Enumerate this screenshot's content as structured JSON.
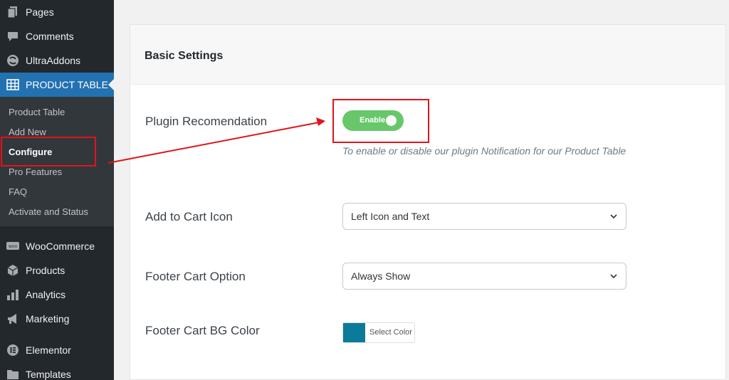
{
  "sidebar": {
    "items": [
      {
        "label": "Pages",
        "icon": "pages-icon"
      },
      {
        "label": "Comments",
        "icon": "comments-icon"
      },
      {
        "label": "UltraAddons",
        "icon": "ultraaddons-icon"
      },
      {
        "label": "PRODUCT TABLE",
        "icon": "table-icon"
      },
      {
        "label": "WooCommerce",
        "icon": "woocommerce-icon"
      },
      {
        "label": "Products",
        "icon": "products-icon"
      },
      {
        "label": "Analytics",
        "icon": "analytics-icon"
      },
      {
        "label": "Marketing",
        "icon": "marketing-icon"
      },
      {
        "label": "Elementor",
        "icon": "elementor-icon"
      },
      {
        "label": "Templates",
        "icon": "templates-icon"
      }
    ],
    "submenu": [
      {
        "label": "Product Table"
      },
      {
        "label": "Add New"
      },
      {
        "label": "Configure"
      },
      {
        "label": "Pro Features"
      },
      {
        "label": "FAQ"
      },
      {
        "label": "Activate and Status"
      }
    ]
  },
  "panel": {
    "title": "Basic Settings",
    "plugin_recommendation": {
      "label": "Plugin Recomendation",
      "toggle_text": "Enable",
      "help": "To enable or disable our plugin Notification for our Product Table"
    },
    "add_to_cart_icon": {
      "label": "Add to Cart Icon",
      "value": "Left Icon and Text"
    },
    "footer_cart_option": {
      "label": "Footer Cart Option",
      "value": "Always Show"
    },
    "footer_cart_bg": {
      "label": "Footer Cart BG Color",
      "picker_label": "Select Color",
      "color": "#0b7b99"
    }
  },
  "colors": {
    "accent": "#2271b1",
    "toggle": "#67c76a",
    "highlight": "#e0141a"
  }
}
